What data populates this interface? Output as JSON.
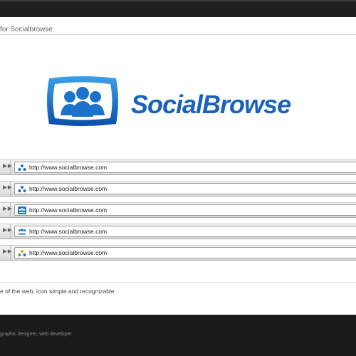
{
  "header": {
    "text": "for Socialbrowse"
  },
  "logo": {
    "wordmark": "SocialBrowse",
    "brand_color": "#1a63b8"
  },
  "bars": [
    {
      "url": "http://www.socialbrowse.com",
      "favicon": "three-dots-icon"
    },
    {
      "url": "http://www.socialbrowse.com",
      "favicon": "three-dots-icon"
    },
    {
      "url": "http://www.socialbrowse.com",
      "favicon": "people-icon"
    },
    {
      "url": "http://www.socialbrowse.com",
      "favicon": "people-icon"
    },
    {
      "url": "http://www.socialbrowse.com",
      "favicon": "colored-dots-icon"
    }
  ],
  "footer": {
    "text": "e of the web, icon simple and recognizable"
  },
  "credit": {
    "text": "graphic designer, web developer"
  }
}
